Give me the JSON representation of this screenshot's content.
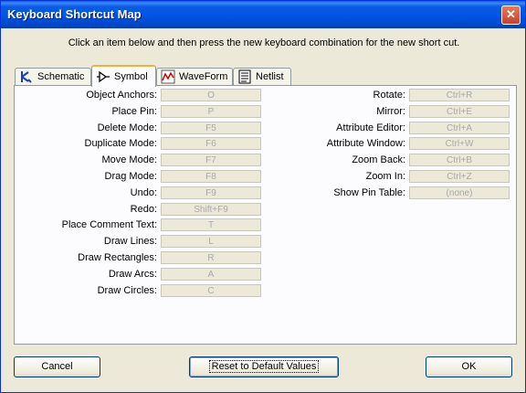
{
  "window": {
    "title": "Keyboard Shortcut Map"
  },
  "instruction": "Click an item below and then press the new keyboard combination for the new short cut.",
  "tabs": [
    {
      "label": "Schematic",
      "icon": "schematic-icon"
    },
    {
      "label": "Symbol",
      "icon": "symbol-icon",
      "active": true
    },
    {
      "label": "WaveForm",
      "icon": "waveform-icon"
    },
    {
      "label": "Netlist",
      "icon": "netlist-icon"
    }
  ],
  "left_shortcuts": [
    {
      "label": "Object Anchors:",
      "value": "O"
    },
    {
      "label": "Place Pin:",
      "value": "P"
    },
    {
      "label": "Delete Mode:",
      "value": "F5"
    },
    {
      "label": "Duplicate Mode:",
      "value": "F6"
    },
    {
      "label": "Move Mode:",
      "value": "F7"
    },
    {
      "label": "Drag Mode:",
      "value": "F8"
    },
    {
      "label": "Undo:",
      "value": "F9"
    },
    {
      "label": "Redo:",
      "value": "Shift+F9"
    },
    {
      "label": "Place Comment Text:",
      "value": "T"
    },
    {
      "label": "Draw Lines:",
      "value": "L"
    },
    {
      "label": "Draw Rectangles:",
      "value": "R"
    },
    {
      "label": "Draw Arcs:",
      "value": "A"
    },
    {
      "label": "Draw Circles:",
      "value": "C"
    }
  ],
  "right_shortcuts": [
    {
      "label": "Rotate:",
      "value": "Ctrl+R"
    },
    {
      "label": "Mirror:",
      "value": "Ctrl+E"
    },
    {
      "label": "Attribute Editor:",
      "value": "Ctrl+A"
    },
    {
      "label": "Attribute Window:",
      "value": "Ctrl+W"
    },
    {
      "label": "Zoom Back:",
      "value": "Ctrl+B"
    },
    {
      "label": "Zoom In:",
      "value": "Ctrl+Z"
    },
    {
      "label": "Show Pin Table:",
      "value": "(none)"
    }
  ],
  "buttons": {
    "cancel": "Cancel",
    "reset": "Reset to Default Values",
    "ok": "OK"
  },
  "colors": {
    "titlebar": "#0a5ce6",
    "panel": "#fcfcfe",
    "window_bg": "#ece9d8",
    "active_tab_accent": "#f0b333"
  }
}
